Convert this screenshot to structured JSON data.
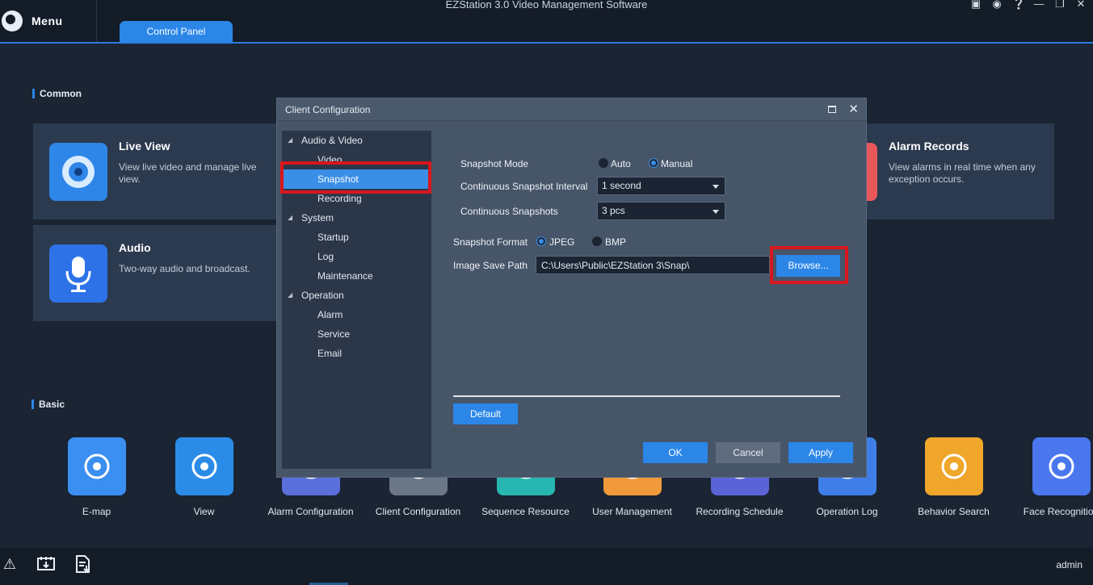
{
  "topbar": {
    "menu_label": "Menu",
    "app_title": "EZStation 3.0 Video Management Software",
    "active_tab": "Control Panel"
  },
  "sections": {
    "common": "Common",
    "basic": "Basic"
  },
  "cards": [
    {
      "title": "Live View",
      "desc": "View live video and manage live view."
    },
    {
      "title": "Alarm Records",
      "desc": "View alarms in real time when any exception occurs."
    },
    {
      "title": "Audio",
      "desc": "Two-way audio and broadcast."
    }
  ],
  "basic": [
    {
      "label": "E-map",
      "color": "#3a8ff0"
    },
    {
      "label": "View",
      "color": "#2b8ce8"
    },
    {
      "label": "Alarm Configuration",
      "color": "#5a6fd9"
    },
    {
      "label": "Client Configuration",
      "color": "#6b7686"
    },
    {
      "label": "Sequence Resource",
      "color": "#27b6b0"
    },
    {
      "label": "User Management",
      "color": "#f09a3c"
    },
    {
      "label": "Recording Schedule",
      "color": "#5a64d6"
    },
    {
      "label": "Operation Log",
      "color": "#3f7ee8"
    },
    {
      "label": "Behavior Search",
      "color": "#f0a62a"
    },
    {
      "label": "Face Recognition",
      "color": "#4a76ee"
    }
  ],
  "statusbar": {
    "user": "admin"
  },
  "modal": {
    "title": "Client Configuration",
    "tree": [
      {
        "label": "Audio & Video",
        "level": 0
      },
      {
        "label": "Video",
        "level": 1
      },
      {
        "label": "Snapshot",
        "level": 1,
        "selected": true
      },
      {
        "label": "Recording",
        "level": 1
      },
      {
        "label": "System",
        "level": 0
      },
      {
        "label": "Startup",
        "level": 1
      },
      {
        "label": "Log",
        "level": 1
      },
      {
        "label": "Maintenance",
        "level": 1
      },
      {
        "label": "Operation",
        "level": 0
      },
      {
        "label": "Alarm",
        "level": 1
      },
      {
        "label": "Service",
        "level": 1
      },
      {
        "label": "Email",
        "level": 1
      }
    ],
    "snapshot_mode_label": "Snapshot Mode",
    "mode_auto": "Auto",
    "mode_manual": "Manual",
    "mode_selected": "Manual",
    "interval_label": "Continuous Snapshot Interval",
    "interval_value": "1 second",
    "count_label": "Continuous Snapshots",
    "count_value": "3 pcs",
    "format_label": "Snapshot Format",
    "format_jpeg": "JPEG",
    "format_bmp": "BMP",
    "format_selected": "JPEG",
    "path_label": "Image Save Path",
    "path_value": "C:\\Users\\Public\\EZStation 3\\Snap\\",
    "browse": "Browse...",
    "default": "Default",
    "ok": "OK",
    "cancel": "Cancel",
    "apply": "Apply"
  }
}
